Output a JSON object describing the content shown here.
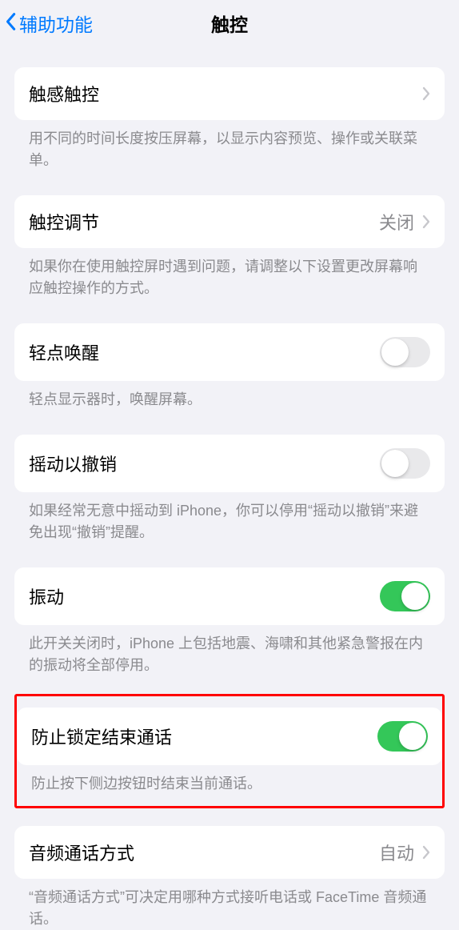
{
  "nav": {
    "back_label": "辅助功能",
    "title": "触控"
  },
  "sections": {
    "haptic": {
      "label": "触感触控",
      "footer": "用不同的时间长度按压屏幕，以显示内容预览、操作或关联菜单。"
    },
    "accommodations": {
      "label": "触控调节",
      "value": "关闭",
      "footer": "如果你在使用触控屏时遇到问题，请调整以下设置更改屏幕响应触控操作的方式。"
    },
    "tap_wake": {
      "label": "轻点唤醒",
      "on": false,
      "footer": "轻点显示器时，唤醒屏幕。"
    },
    "shake_undo": {
      "label": "摇动以撤销",
      "on": false,
      "footer": "如果经常无意中摇动到 iPhone，你可以停用“摇动以撤销”来避免出现“撤销”提醒。"
    },
    "vibration": {
      "label": "振动",
      "on": true,
      "footer": "此开关关闭时，iPhone 上包括地震、海啸和其他紧急警报在内的振动将全部停用。"
    },
    "prevent_lock": {
      "label": "防止锁定结束通话",
      "on": true,
      "footer": "防止按下侧边按钮时结束当前通话。"
    },
    "audio_routing": {
      "label": "音频通话方式",
      "value": "自动",
      "footer": "“音频通话方式”可决定用哪种方式接听电话或 FaceTime 音频通话。"
    }
  }
}
